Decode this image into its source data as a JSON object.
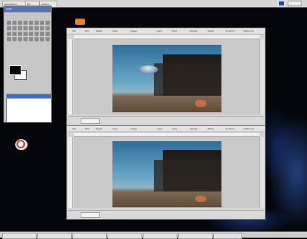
{
  "top_panel": {
    "buttons": [
      "Applications",
      "File",
      "Actions"
    ]
  },
  "toolbox": {
    "title": "GIMP"
  },
  "image_window_1": {
    "menus": [
      "File",
      "Edit",
      "Select",
      "View",
      "Image",
      "Layer",
      "Tools",
      "Dialogs",
      "Filters",
      "Script-Fu",
      "Python-Fu"
    ]
  },
  "image_window_2": {
    "menus": [
      "File",
      "Edit",
      "Select",
      "View",
      "Image",
      "Layer",
      "Tools",
      "Dialogs",
      "Filters",
      "Script-Fu",
      "Python-Fu"
    ]
  },
  "colors": {
    "desktop": "#04060b",
    "accent_blue": "#3c6ad3",
    "window_gray": "#d4d4d4",
    "launcher_orange": "#e8822a"
  }
}
